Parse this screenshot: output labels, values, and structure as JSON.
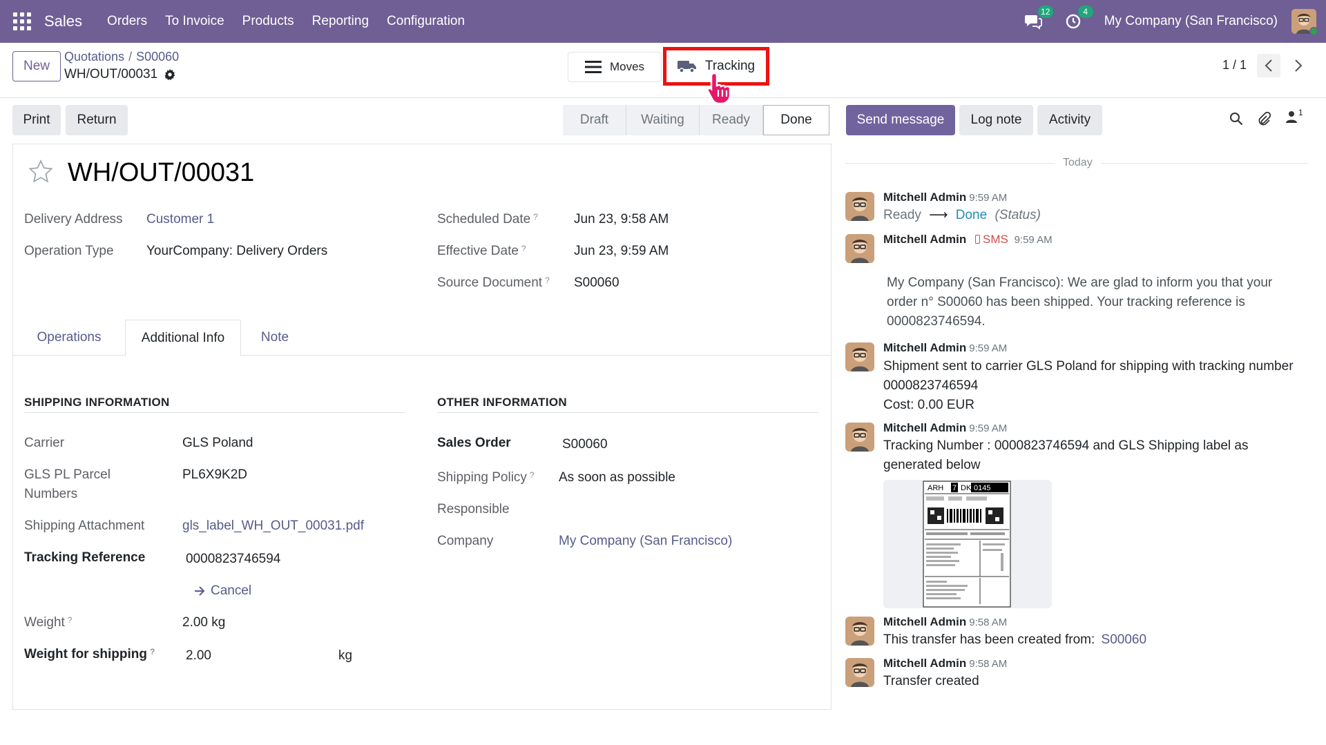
{
  "navbar": {
    "app": "Sales",
    "menu": [
      "Orders",
      "To Invoice",
      "Products",
      "Reporting",
      "Configuration"
    ],
    "messages_count": "12",
    "activities_count": "4",
    "company": "My Company (San Francisco)"
  },
  "control": {
    "new_label": "New",
    "breadcrumb": [
      "Quotations",
      "S00060"
    ],
    "record_name": "WH/OUT/00031",
    "moves_label": "Moves",
    "tracking_label": "Tracking",
    "pager": "1 / 1"
  },
  "actions": {
    "print": "Print",
    "return": "Return",
    "stages": [
      "Draft",
      "Waiting",
      "Ready",
      "Done"
    ],
    "current_stage": "Done",
    "send_message": "Send message",
    "log_note": "Log note",
    "activity": "Activity",
    "followers_count": "1"
  },
  "form": {
    "title": "WH/OUT/00031",
    "delivery_address_label": "Delivery Address",
    "delivery_address": "Customer 1",
    "operation_type_label": "Operation Type",
    "operation_type": "YourCompany: Delivery Orders",
    "scheduled_date_label": "Scheduled Date",
    "scheduled_date": "Jun 23, 9:58 AM",
    "effective_date_label": "Effective Date",
    "effective_date": "Jun 23, 9:59 AM",
    "source_document_label": "Source Document",
    "source_document": "S00060",
    "help_mark": "?",
    "tabs": [
      "Operations",
      "Additional Info",
      "Note"
    ],
    "shipping": {
      "heading": "SHIPPING INFORMATION",
      "carrier_label": "Carrier",
      "carrier": "GLS Poland",
      "parcel_label_1": "GLS PL Parcel",
      "parcel_label_2": "Numbers",
      "parcel": "PL6X9K2D",
      "attachment_label": "Shipping Attachment",
      "attachment": "gls_label_WH_OUT_00031.pdf",
      "tracking_label": "Tracking Reference",
      "tracking": "0000823746594",
      "cancel_label": "Cancel",
      "weight_label": "Weight",
      "weight": "2.00 kg",
      "weight_shipping_label": "Weight for shipping",
      "weight_shipping": "2.00",
      "weight_unit": "kg"
    },
    "other": {
      "heading": "OTHER INFORMATION",
      "sales_order_label": "Sales Order",
      "sales_order": "S00060",
      "shipping_policy_label": "Shipping Policy",
      "shipping_policy": "As soon as possible",
      "responsible_label": "Responsible",
      "company_label": "Company",
      "company": "My Company (San Francisco)"
    }
  },
  "chatter": {
    "today": "Today",
    "messages": [
      {
        "author": "Mitchell Admin",
        "time": "9:59 AM",
        "from": "Ready",
        "arrow": "⟶",
        "to": "Done",
        "field": "(Status)"
      },
      {
        "author": "Mitchell Admin",
        "sms": "SMS",
        "time": "9:59 AM",
        "lines": [
          "My Company (San Francisco): We are glad to inform you that your",
          "order n° S00060 has been shipped. Your tracking reference is",
          "0000823746594."
        ]
      },
      {
        "author": "Mitchell Admin",
        "time": "9:59 AM",
        "lines": [
          "Shipment sent to carrier GLS Poland for shipping with tracking number",
          "0000823746594",
          "Cost: 0.00 EUR"
        ]
      },
      {
        "author": "Mitchell Admin",
        "time": "9:59 AM",
        "lines": [
          "Tracking Number : 0000823746594 and GLS Shipping label as",
          "generated below"
        ]
      },
      {
        "author": "Mitchell Admin",
        "time": "9:58 AM",
        "text": "This transfer has been created from:",
        "link": "S00060"
      },
      {
        "author": "Mitchell Admin",
        "time": "9:58 AM",
        "text": "Transfer created"
      }
    ],
    "label_image": {
      "codes": [
        "ARH",
        "7",
        "DK",
        "0145"
      ]
    }
  }
}
